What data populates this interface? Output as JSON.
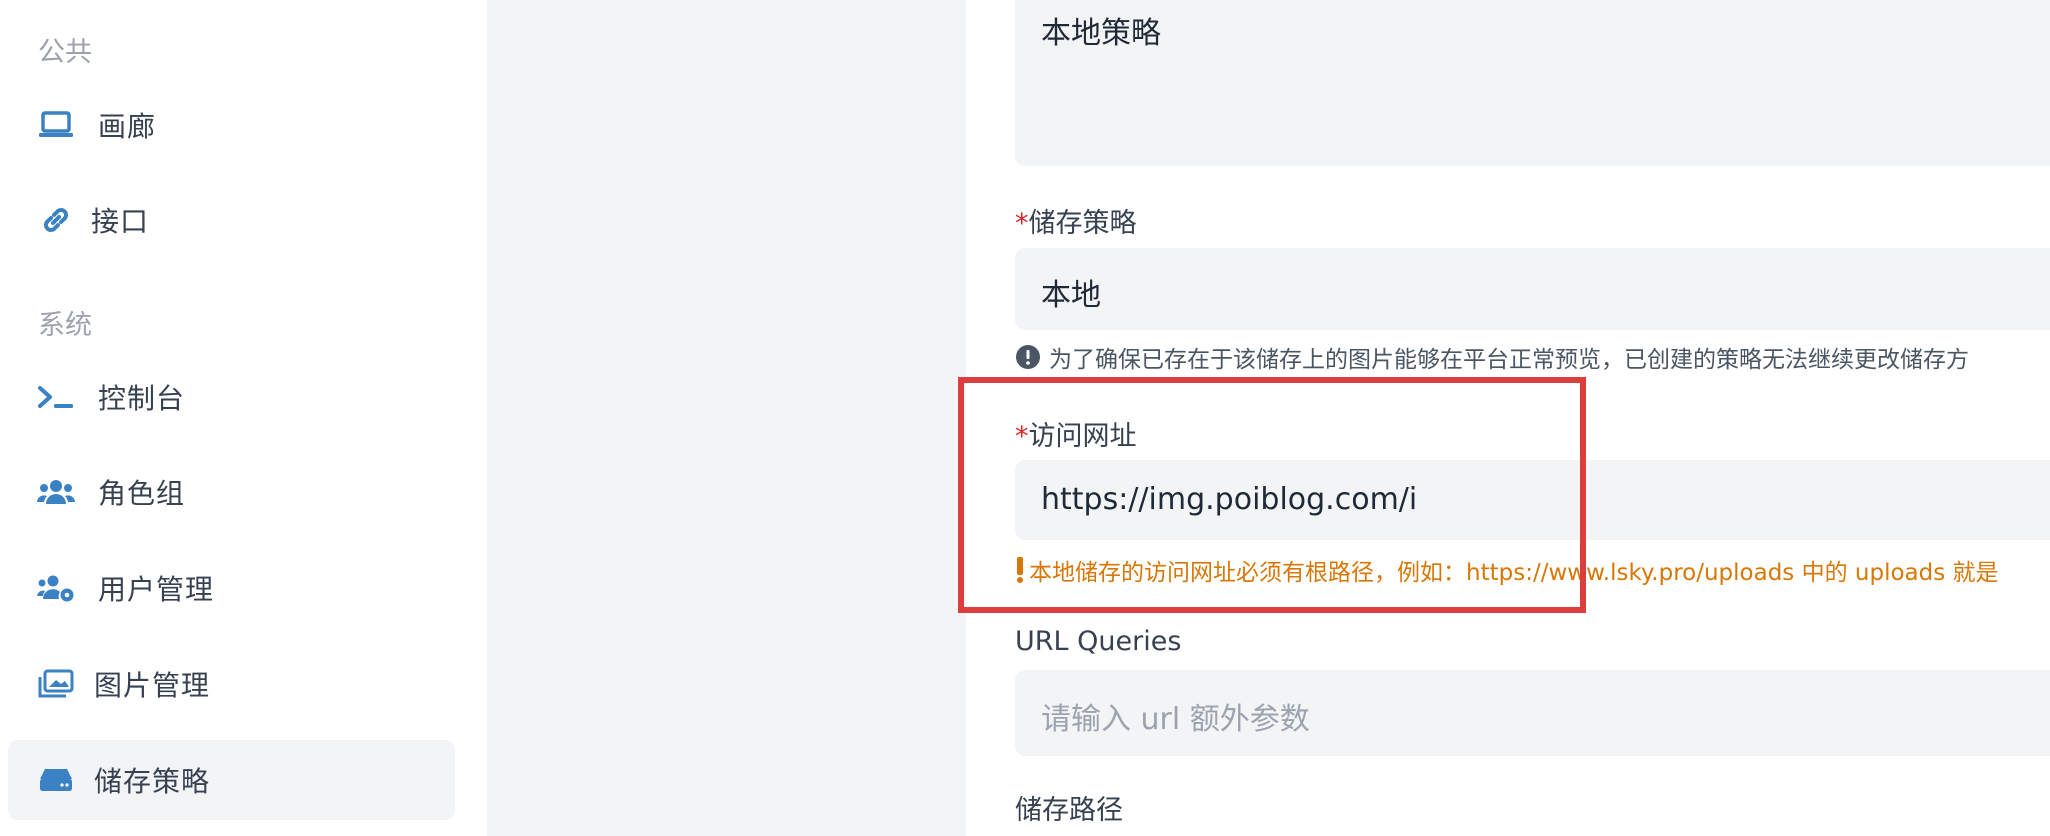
{
  "sidebar": {
    "public_title": "公共",
    "system_title": "系统",
    "items": [
      {
        "label": "画廊",
        "icon": "laptop-icon"
      },
      {
        "label": "接口",
        "icon": "link-icon"
      },
      {
        "label": "控制台",
        "icon": "terminal-icon"
      },
      {
        "label": "角色组",
        "icon": "users-icon"
      },
      {
        "label": "用户管理",
        "icon": "users-gear-icon"
      },
      {
        "label": "图片管理",
        "icon": "images-icon"
      },
      {
        "label": "储存策略",
        "icon": "hard-drive-icon"
      }
    ],
    "active_index": 6
  },
  "form": {
    "description_value": "本地策略",
    "storage_label": "储存策略",
    "storage_value": "本地",
    "storage_hint": "为了确保已存在于该储存上的图片能够在平台正常预览，已创建的策略无法继续更改储存方",
    "url_label": "访问网址",
    "url_value": "https://img.poiblog.com/i",
    "url_hint": "本地储存的访问网址必须有根路径，例如：https://www.lsky.pro/uploads 中的 uploads 就是",
    "queries_label": "URL Queries",
    "queries_placeholder": "请输入 url 额外参数",
    "path_label": "储存路径"
  },
  "colors": {
    "accent": "#3b82c4",
    "required": "#dc2626",
    "warning": "#d97706",
    "highlight_box": "#dc3d3d"
  }
}
